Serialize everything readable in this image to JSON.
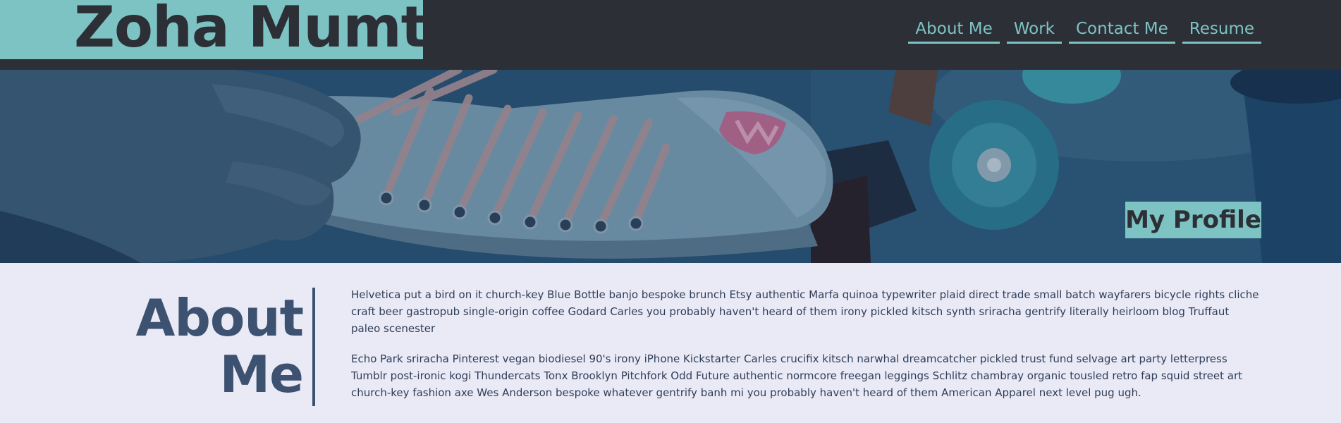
{
  "site": {
    "name": "Zoha Mumtaz"
  },
  "nav": {
    "items": [
      {
        "label": "About Me"
      },
      {
        "label": "Work"
      },
      {
        "label": "Contact Me"
      },
      {
        "label": "Resume"
      }
    ]
  },
  "hero": {
    "badge": "My Profile"
  },
  "about": {
    "heading_line1": "About",
    "heading_line2": "Me",
    "paragraphs": [
      "Helvetica put a bird on it church-key Blue Bottle banjo bespoke brunch Etsy authentic Marfa quinoa typewriter plaid direct trade small batch wayfarers bicycle rights cliche craft beer gastropub single-origin coffee Godard Carles you probably haven't heard of them irony pickled kitsch synth sriracha gentrify literally heirloom blog Truffaut paleo scenester",
      "Echo Park sriracha Pinterest vegan biodiesel 90's irony iPhone Kickstarter Carles crucifix kitsch narwhal dreamcatcher pickled trust fund selvage art party letterpress Tumblr post-ironic kogi Thundercats Tonx Brooklyn Pitchfork Odd Future authentic normcore freegan leggings Schlitz chambray organic tousled retro fap squid street art church-key fashion axe Wes Anderson bespoke whatever gentrify banh mi you probably haven't heard of them American Apparel next level pug ugh."
    ]
  },
  "colors": {
    "accent": "#7ec3c3",
    "header_bg": "#2c2f36",
    "heading": "#3d5170",
    "page_bg": "#e9eaf5"
  }
}
